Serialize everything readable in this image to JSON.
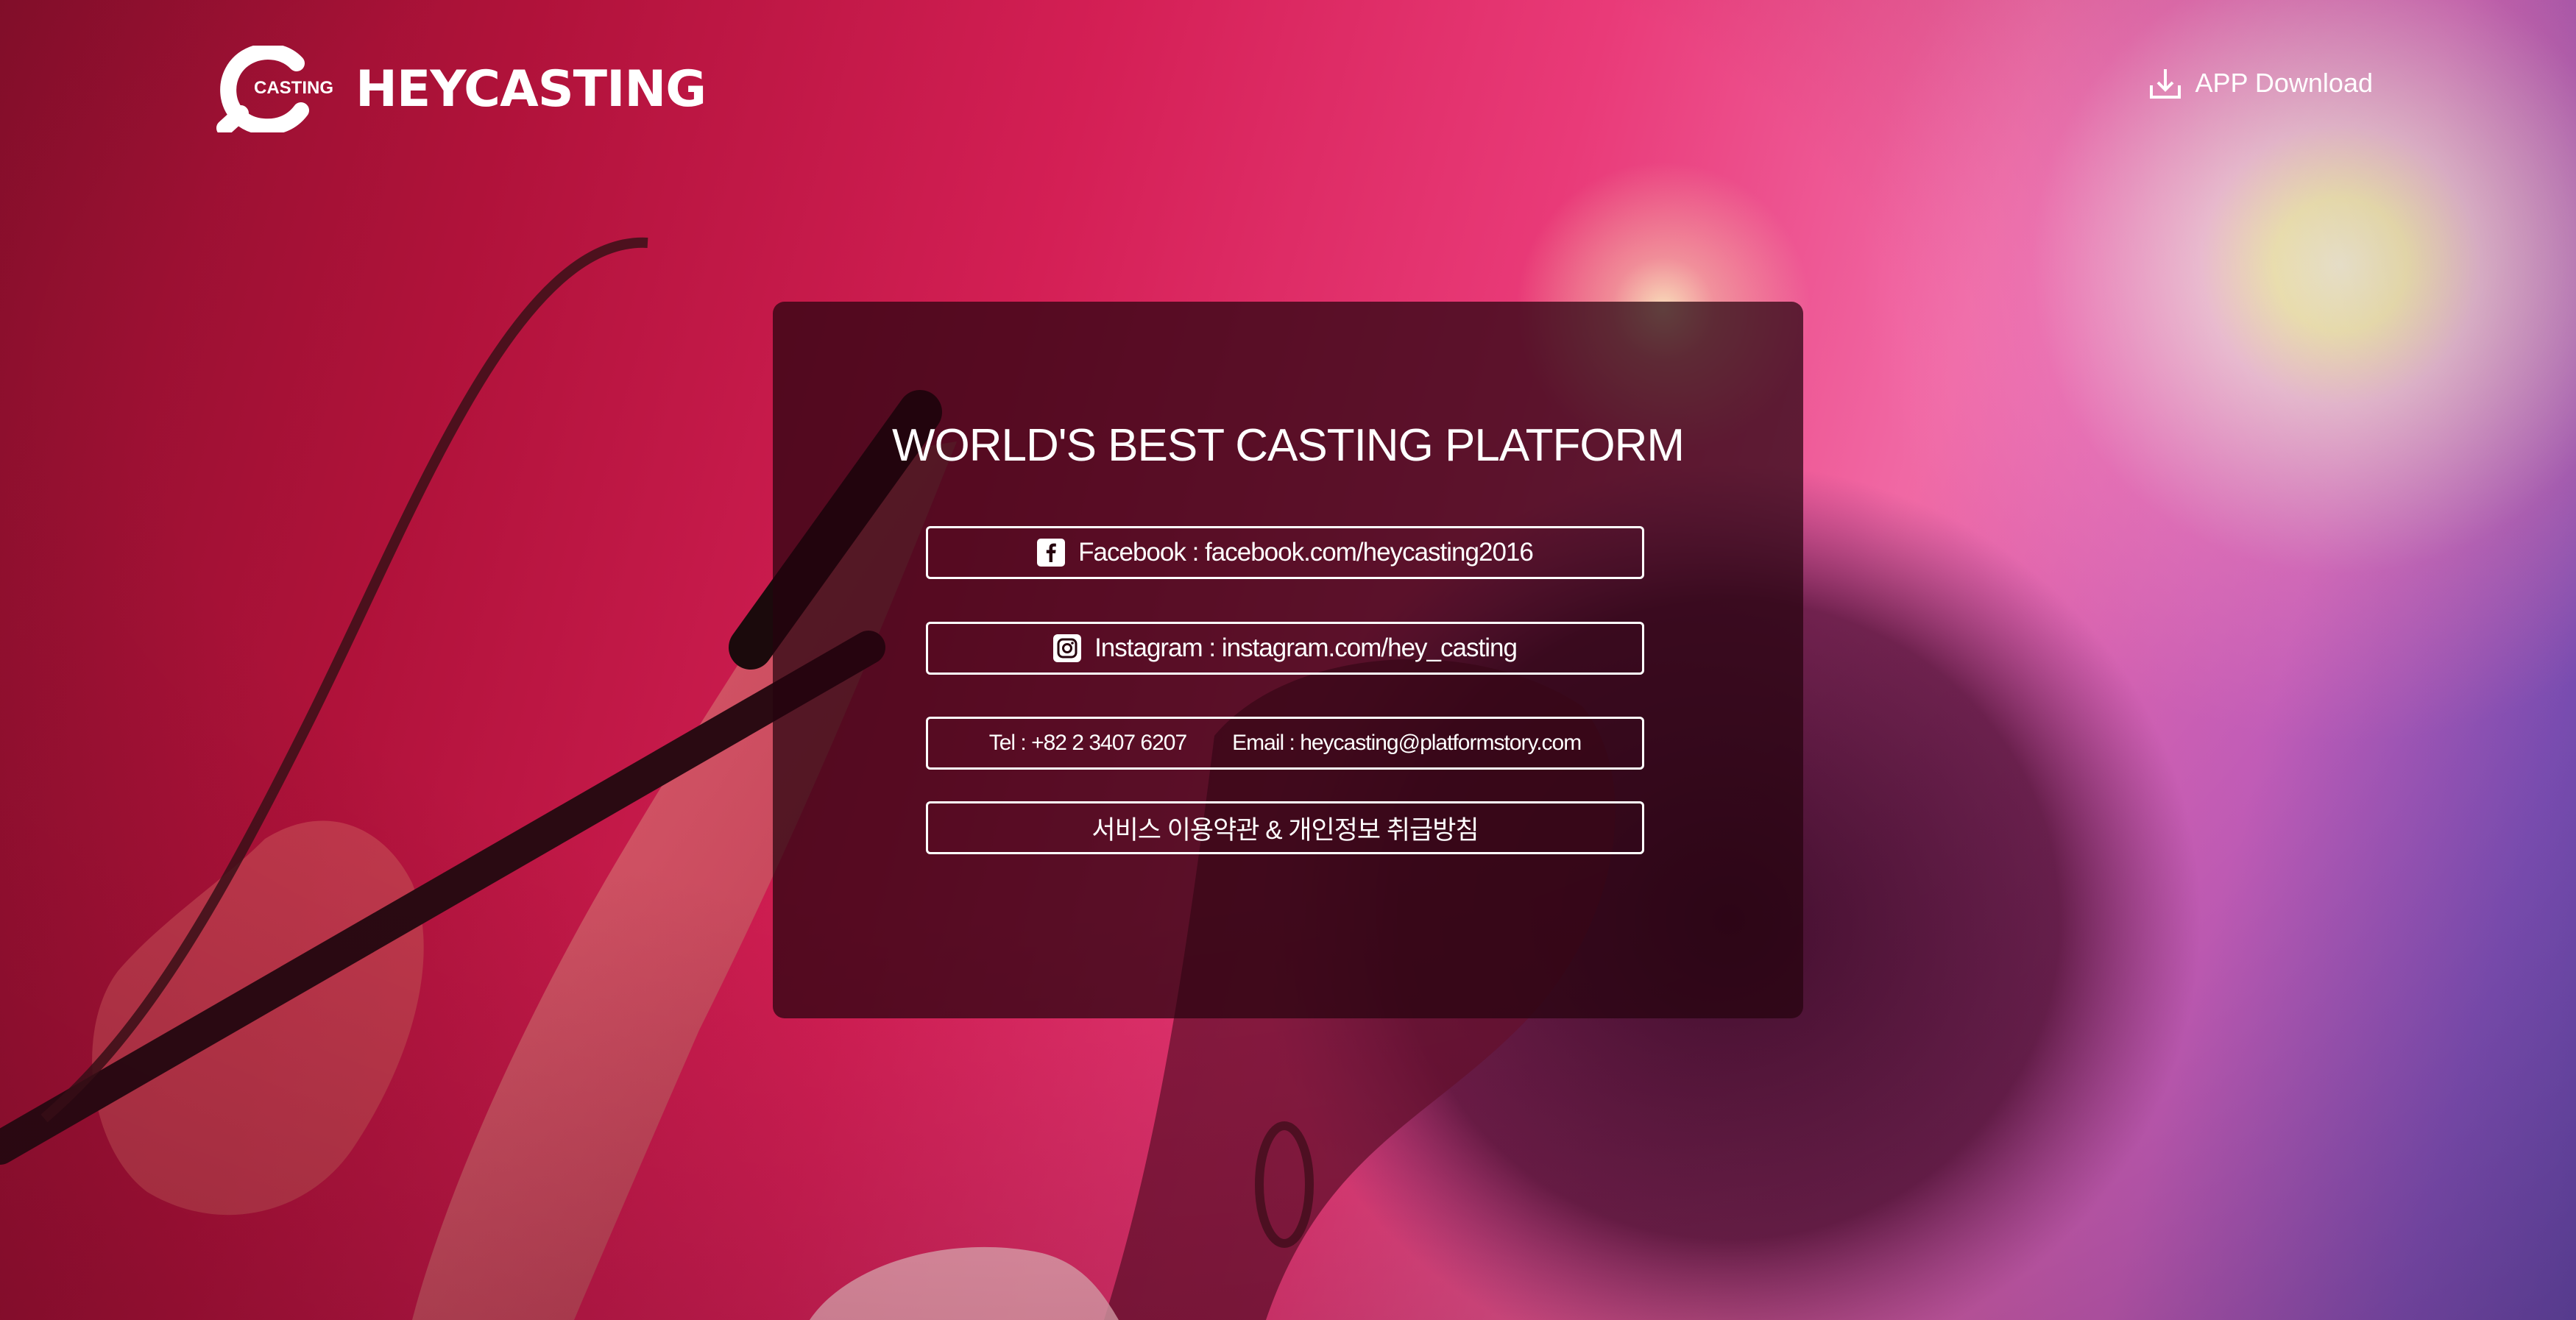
{
  "header": {
    "logo_mark_text": "CASTING",
    "logo_word": "HEYCASTING",
    "app_download_label": "APP Download"
  },
  "panel": {
    "headline": "WORLD'S BEST CASTING PLATFORM",
    "facebook": {
      "icon": "facebook-icon",
      "text": "Facebook : facebook.com/heycasting2016"
    },
    "instagram": {
      "icon": "instagram-icon",
      "text": "Instagram : instagram.com/hey_casting"
    },
    "contact": {
      "tel": "Tel : +82 2 3407 6207",
      "email": "Email : heycasting@platformstory.com"
    },
    "terms": "서비스 이용약관 & 개인정보 취급방침"
  },
  "colors": {
    "background_primary": "#d41f55",
    "background_accent": "#8d5fd8",
    "panel": "#26030e",
    "text": "#ffffff"
  }
}
